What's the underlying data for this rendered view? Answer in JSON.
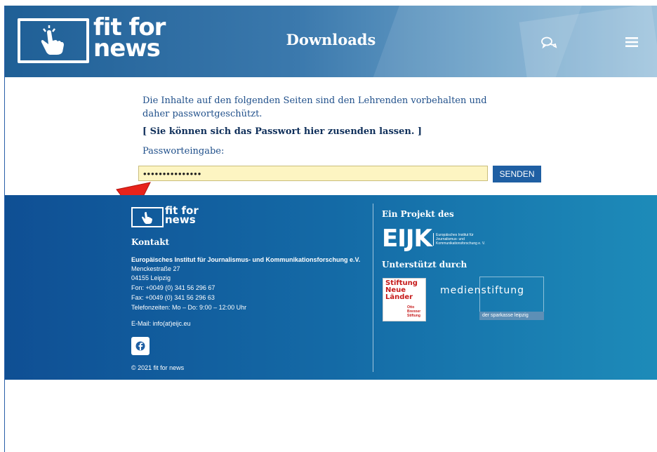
{
  "header": {
    "logo_line1": "fit for",
    "logo_line2": "news",
    "page_title": "Downloads",
    "chat_icon": "chat-bubbles-icon",
    "menu_icon": "hamburger-menu-icon"
  },
  "content": {
    "intro_text": "Die Inhalte auf den folgenden Seiten sind den Lehrenden vorbehalten und daher passwortgeschützt.",
    "send_password_link": "[ Sie können sich das Passwort hier zusenden lassen. ]",
    "password_label": "Passworteingabe:",
    "password_value": "•••••••••••••••",
    "send_button": "SENDEN"
  },
  "footer": {
    "logo_line1": "fit for",
    "logo_line2": "news",
    "contact_heading": "Kontakt",
    "org_name": "Europäisches Institut für Journalismus- und Kommunikationsforschung e.V.",
    "street": "Menckestraße 27",
    "city": "04155 Leipzig",
    "phone": "Fon: +0049 (0) 341 56 296 67",
    "fax": "Fax: +0049 (0) 341 56 296 63",
    "hours": "Telefonzeiten: Mo – Do: 9:00 – 12:00 Uhr",
    "email": "E-Mail: info(at)eijc.eu",
    "facebook_icon": "facebook-icon",
    "copyright": "© 2021 fit for news",
    "project_heading": "Ein Projekt des",
    "eijk_logo": "EIJK",
    "eijk_sub1": "Europäisches Institut für",
    "eijk_sub2": "Journalismus- und",
    "eijk_sub3": "Kommunikationsforschung e. V.",
    "supported_heading": "Unterstützt durch",
    "sn_line1": "Stiftung",
    "sn_line2": "Neue",
    "sn_line3": "Länder",
    "sn_small1": "Otto",
    "sn_small2": "Brenner",
    "sn_small3": "Stiftung",
    "ms_text": "medienstiftung",
    "ms_bar": "der sparkasse leipzig"
  },
  "colors": {
    "accent": "#1f5fa3",
    "input_bg": "#fdf5c2",
    "arrow": "#e8231b"
  }
}
